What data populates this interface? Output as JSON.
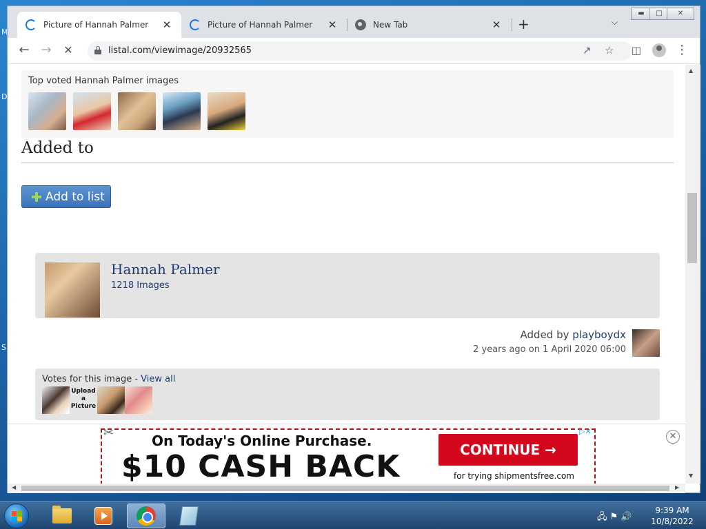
{
  "browser": {
    "tabs": [
      {
        "title": "Picture of Hannah Palmer",
        "active": true,
        "icon": "loading-spinner-icon"
      },
      {
        "title": "Picture of Hannah Palmer",
        "active": false,
        "icon": "loading-spinner-icon"
      },
      {
        "title": "New Tab",
        "active": false,
        "icon": "chrome-icon"
      }
    ],
    "new_tab": "+",
    "tab_close": "✕",
    "url": "listal.com/viewimage/20932565"
  },
  "page": {
    "top_voted_label": "Top voted Hannah Palmer images",
    "added_to_heading": "Added to",
    "add_to_list_button": "Add to list",
    "person": {
      "name": "Hannah Palmer",
      "image_count": "1218 Images"
    },
    "added_by_prefix": "Added by ",
    "added_by_user": "playboydx",
    "added_date": "2 years ago on 1 April 2020 06:00",
    "votes_label": "Votes for this image - ",
    "votes_link": "View all",
    "upload_placeholder": "Upload a Picture"
  },
  "ad": {
    "line1": "On Today's Online Purchase.",
    "line2": "$10 CASH BACK",
    "cta": "CONTINUE →",
    "subtext": "for trying shipmentsfree.com",
    "close": "✕",
    "choices": "▷✕"
  },
  "taskbar": {
    "time": "9:39 AM",
    "date": "10/8/2022"
  },
  "colors": {
    "link": "#1f3b70",
    "button": "#3b74ba",
    "ad_red": "#d4081c"
  }
}
